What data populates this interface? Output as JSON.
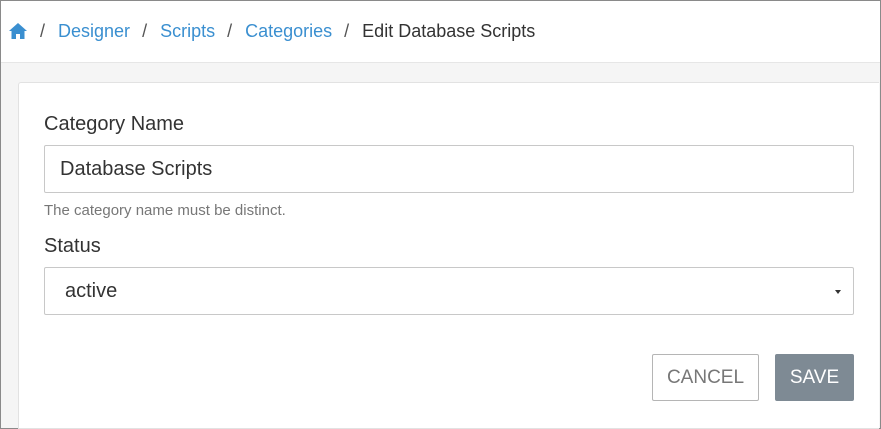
{
  "breadcrumb": {
    "home_icon": "home-icon",
    "separator": "/",
    "items": [
      {
        "label": "Designer"
      },
      {
        "label": "Scripts"
      },
      {
        "label": "Categories"
      }
    ],
    "current": "Edit Database Scripts"
  },
  "form": {
    "category_name": {
      "label": "Category Name",
      "value": "Database Scripts",
      "help_text": "The category name must be distinct."
    },
    "status": {
      "label": "Status",
      "value": "active",
      "arrow_icon": "caret-down-icon"
    },
    "buttons": {
      "cancel_label": "CANCEL",
      "save_label": "SAVE"
    }
  },
  "colors": {
    "link": "#3a8fd0",
    "save_button": "#7e8a94",
    "page_background": "#f5f5f5"
  }
}
